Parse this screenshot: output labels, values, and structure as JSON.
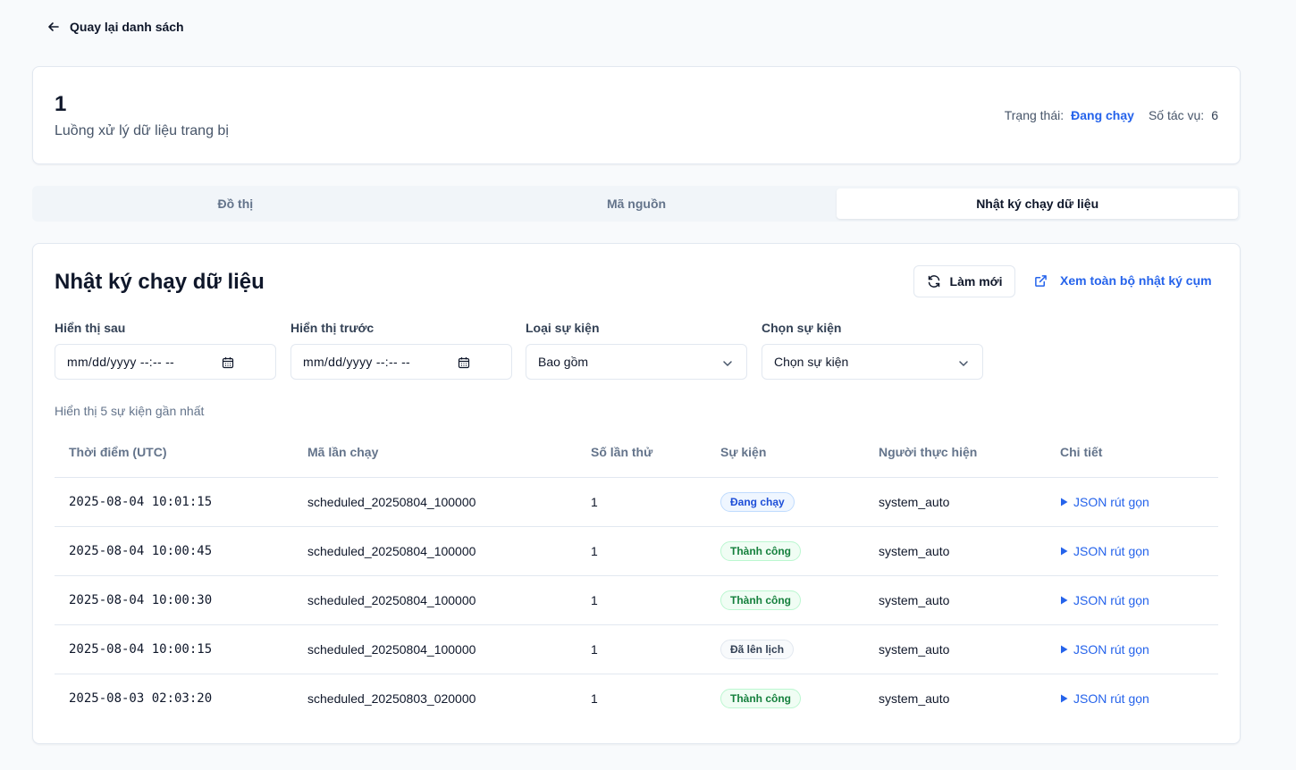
{
  "back": {
    "label": "Quay lại danh sách"
  },
  "pipeline": {
    "title": "1",
    "subtitle": "Luồng xử lý dữ liệu trang bị",
    "status_label": "Trạng thái:",
    "status_value": "Đang chạy",
    "task_count_label": "Số tác vụ:",
    "task_count_value": "6"
  },
  "tabs": [
    {
      "label": "Đồ thị",
      "active": false
    },
    {
      "label": "Mã nguồn",
      "active": false
    },
    {
      "label": "Nhật ký chạy dữ liệu",
      "active": true
    }
  ],
  "log": {
    "title": "Nhật ký chạy dữ liệu",
    "refresh_label": "Làm mới",
    "cluster_link_label": "Xem toàn bộ nhật ký cụm",
    "filters": {
      "after_label": "Hiển thị sau",
      "after_placeholder": "mm/dd/yyyy --:-- --",
      "before_label": "Hiển thị trước",
      "before_placeholder": "mm/dd/yyyy --:-- --",
      "event_type_label": "Loại sự kiện",
      "event_type_value": "Bao gồm",
      "event_label": "Chọn sự kiện",
      "event_value": "Chọn sự kiện"
    },
    "count_note": "Hiển thị 5 sự kiện gần nhất",
    "columns": {
      "time": "Thời điểm (UTC)",
      "run_id": "Mã lần chạy",
      "attempt": "Số lần thử",
      "event": "Sự kiện",
      "actor": "Người thực hiện",
      "detail": "Chi tiết"
    },
    "rows": [
      {
        "time": "2025-08-04 10:01:15",
        "run_id": "scheduled_20250804_100000",
        "attempt": "1",
        "event": "Đang chạy",
        "event_kind": "running",
        "actor": "system_auto",
        "detail": "JSON rút gọn"
      },
      {
        "time": "2025-08-04 10:00:45",
        "run_id": "scheduled_20250804_100000",
        "attempt": "1",
        "event": "Thành công",
        "event_kind": "success",
        "actor": "system_auto",
        "detail": "JSON rút gọn"
      },
      {
        "time": "2025-08-04 10:00:30",
        "run_id": "scheduled_20250804_100000",
        "attempt": "1",
        "event": "Thành công",
        "event_kind": "success",
        "actor": "system_auto",
        "detail": "JSON rút gọn"
      },
      {
        "time": "2025-08-04 10:00:15",
        "run_id": "scheduled_20250804_100000",
        "attempt": "1",
        "event": "Đã lên lịch",
        "event_kind": "scheduled",
        "actor": "system_auto",
        "detail": "JSON rút gọn"
      },
      {
        "time": "2025-08-03 02:03:20",
        "run_id": "scheduled_20250803_020000",
        "attempt": "1",
        "event": "Thành công",
        "event_kind": "success",
        "actor": "system_auto",
        "detail": "JSON rút gọn"
      }
    ]
  },
  "colors": {
    "accent": "#2563eb",
    "success": "#15803d",
    "border": "#e2e8f0",
    "background": "#f8fafc"
  },
  "icons": {
    "back": "arrow-left-icon",
    "refresh": "refresh-icon",
    "external": "external-link-icon",
    "calendar": "calendar-icon",
    "dropdown": "chevron-down-icon",
    "expand": "caret-right-icon"
  }
}
